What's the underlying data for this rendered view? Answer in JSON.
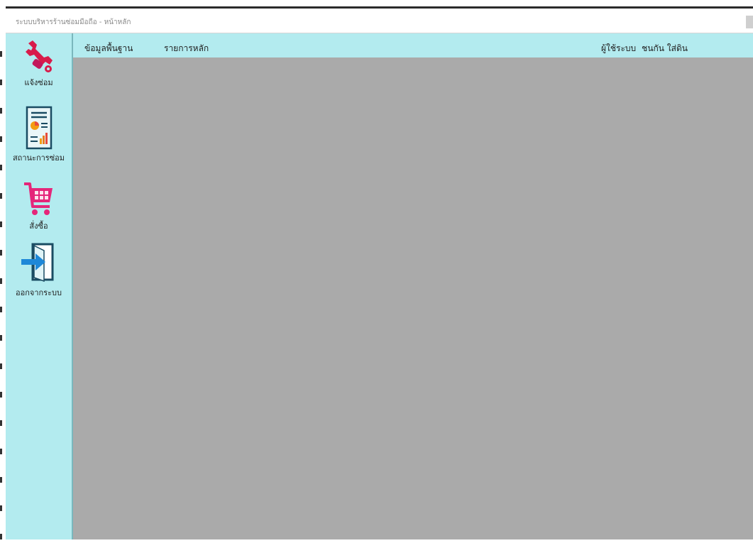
{
  "window": {
    "title": "ระบบบริหารร้านซ่อมมือถือ - หน้าหลัก"
  },
  "sidebar": {
    "items": [
      {
        "label": "แจ้งซ่อม",
        "icon": "wrench-icon"
      },
      {
        "label": "สถานะการซ่อม",
        "icon": "report-icon"
      },
      {
        "label": "สั่งซื้อ",
        "icon": "cart-icon"
      },
      {
        "label": "ออกจากระบบ",
        "icon": "logout-icon"
      }
    ]
  },
  "menubar": {
    "items": [
      {
        "label": "ข้อมูลพื้นฐาน"
      },
      {
        "label": "รายการหลัก"
      }
    ],
    "user_label": "ผู้ใช้ระบบ",
    "user_name": "ชนกัน ใส่ดิน"
  },
  "colors": {
    "sidebar_bg": "#b3ebef",
    "content_bg": "#aaaaaa",
    "icon_red": "#d81b4a",
    "icon_pink": "#e5267a",
    "icon_blue": "#1e88d8"
  }
}
